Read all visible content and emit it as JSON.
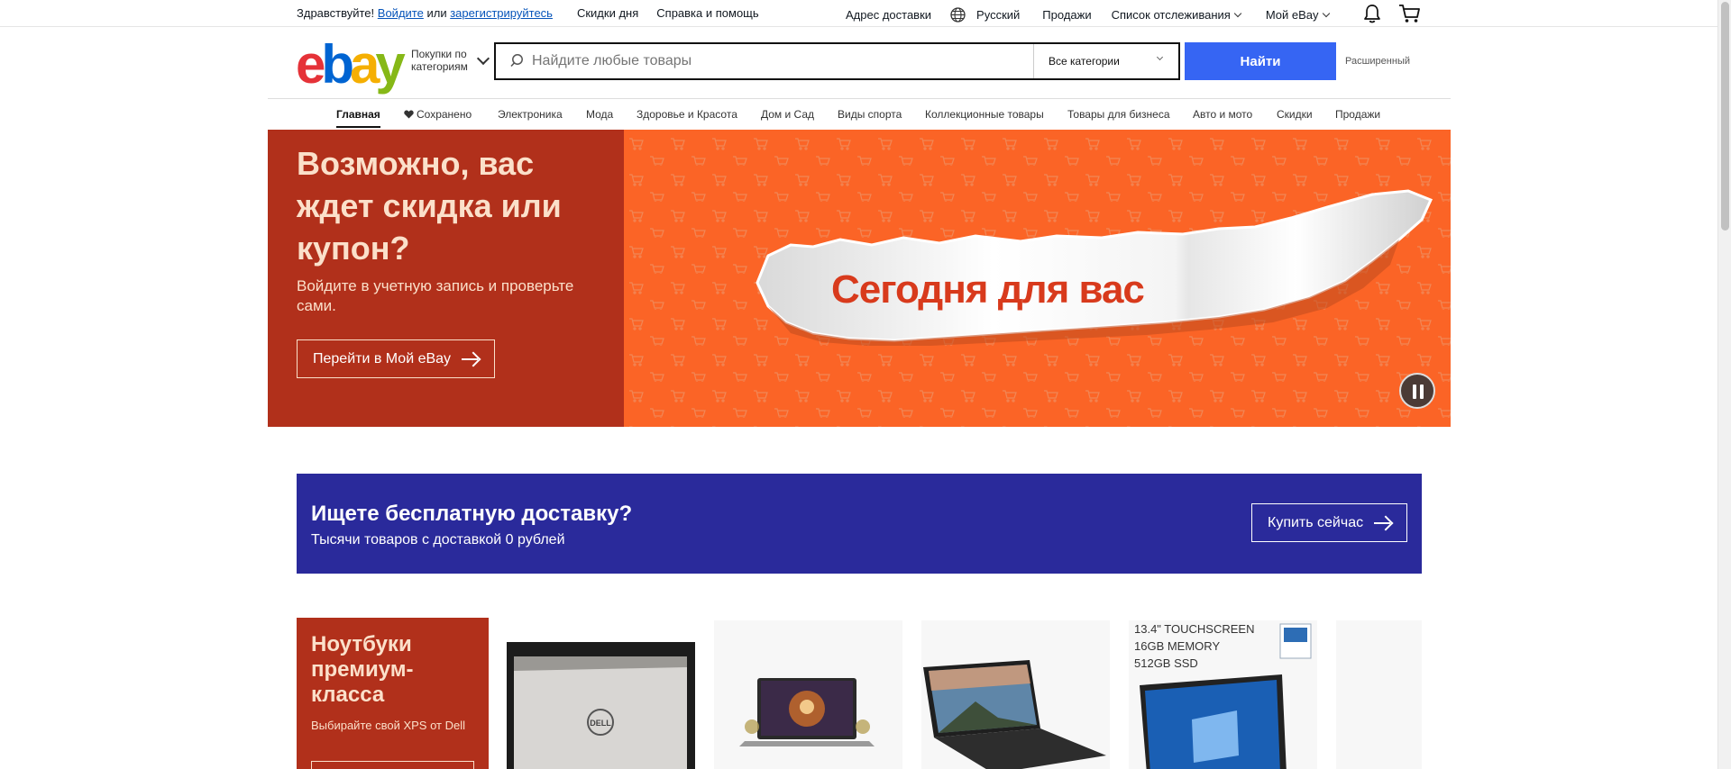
{
  "topbar": {
    "greeting": "Здравствуйте!",
    "signin": "Войдите",
    "or": "или",
    "register": "зарегистрируйтесь",
    "daily_deals": "Скидки дня",
    "help": "Справка и помощь",
    "ship_to": "Адрес доставки",
    "language": "Русский",
    "sell": "Продажи",
    "watchlist": "Список отслеживания",
    "my_ebay": "Мой eBay"
  },
  "header": {
    "logo_letters": [
      "e",
      "b",
      "a",
      "y"
    ],
    "shop_by_category_line1": "Покупки по",
    "shop_by_category_line2": "категориям",
    "search_placeholder": "Найдите любые товары",
    "category_selected": "Все категории",
    "search_button": "Найти",
    "advanced": "Расширенный"
  },
  "nav": {
    "items": [
      {
        "label": "Главная",
        "active": true
      },
      {
        "label": "Сохранено"
      },
      {
        "label": "Электроника"
      },
      {
        "label": "Мода"
      },
      {
        "label": "Здоровье и Красота"
      },
      {
        "label": "Дом и Сад"
      },
      {
        "label": "Виды спорта"
      },
      {
        "label": "Коллекционные товары"
      },
      {
        "label": "Товары для бизнеса"
      },
      {
        "label": "Авто и мото"
      },
      {
        "label": "Скидки"
      },
      {
        "label": "Продажи"
      }
    ]
  },
  "hero": {
    "title": "Возможно, вас ждет скидка или купон?",
    "subtitle": "Войдите в учетную запись и проверьте сами.",
    "button": "Перейти в Мой eBay",
    "banner_text": "Сегодня для вас",
    "colors": {
      "left_bg": "#b1301b",
      "right_bg": "#fb6426",
      "banner_text": "#d83a1c"
    }
  },
  "promo": {
    "title": "Ищете бесплатную доставку?",
    "subtitle": "Тысячи товаров с доставкой 0 рублей",
    "button": "Купить сейчас",
    "color": "#2a2a9b"
  },
  "laptops": {
    "title": "Ноутбуки премиум-класса",
    "subtitle": "Выбирайте свой XPS от Dell",
    "tile4_specs": [
      "13.4\" TOUCHSCREEN",
      "16GB MEMORY",
      "512GB SSD"
    ],
    "tile1_brand": "DELL"
  },
  "colors": {
    "accent": "#3665f3",
    "link": "#0654ba"
  }
}
